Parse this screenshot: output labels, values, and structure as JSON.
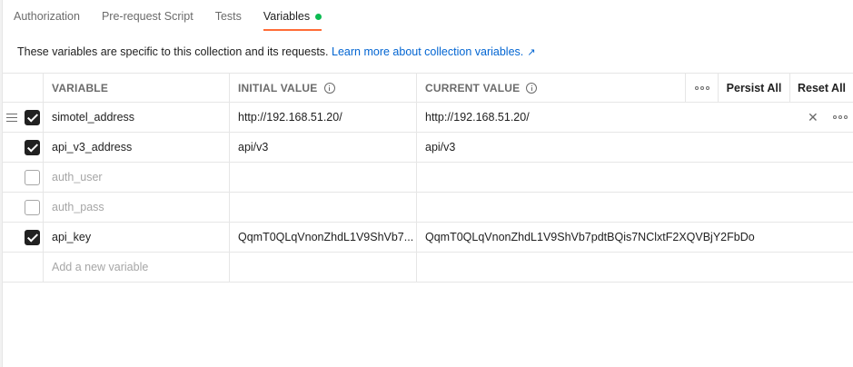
{
  "tabs": [
    {
      "label": "Authorization",
      "active": false
    },
    {
      "label": "Pre-request Script",
      "active": false
    },
    {
      "label": "Tests",
      "active": false
    },
    {
      "label": "Variables",
      "active": true
    }
  ],
  "colors": {
    "accent": "#ff6c37",
    "modified_dot": "#0cbb52",
    "link": "#0265d2"
  },
  "description": {
    "text": "These variables are specific to this collection and its requests.",
    "link_text": "Learn more about collection variables.",
    "arrow": "↗"
  },
  "table": {
    "headers": {
      "variable": "VARIABLE",
      "initial_value": "INITIAL VALUE",
      "current_value": "CURRENT VALUE",
      "persist_all": "Persist All",
      "reset_all": "Reset All"
    },
    "rows": [
      {
        "enabled": true,
        "variable": "simotel_address",
        "initial": "http://192.168.51.20/",
        "current": "http://192.168.51.20/",
        "hovered": true
      },
      {
        "enabled": true,
        "variable": "api_v3_address",
        "initial": "api/v3",
        "current": "api/v3"
      },
      {
        "enabled": false,
        "variable": "auth_user",
        "initial": "",
        "current": ""
      },
      {
        "enabled": false,
        "variable": "auth_pass",
        "initial": "",
        "current": ""
      },
      {
        "enabled": true,
        "variable": "api_key",
        "initial": "QqmT0QLqVnonZhdL1V9ShVb7...",
        "current": "QqmT0QLqVnonZhdL1V9ShVb7pdtBQis7NClxtF2XQVBjY2FbDo"
      }
    ],
    "add_placeholder": "Add a new variable"
  }
}
